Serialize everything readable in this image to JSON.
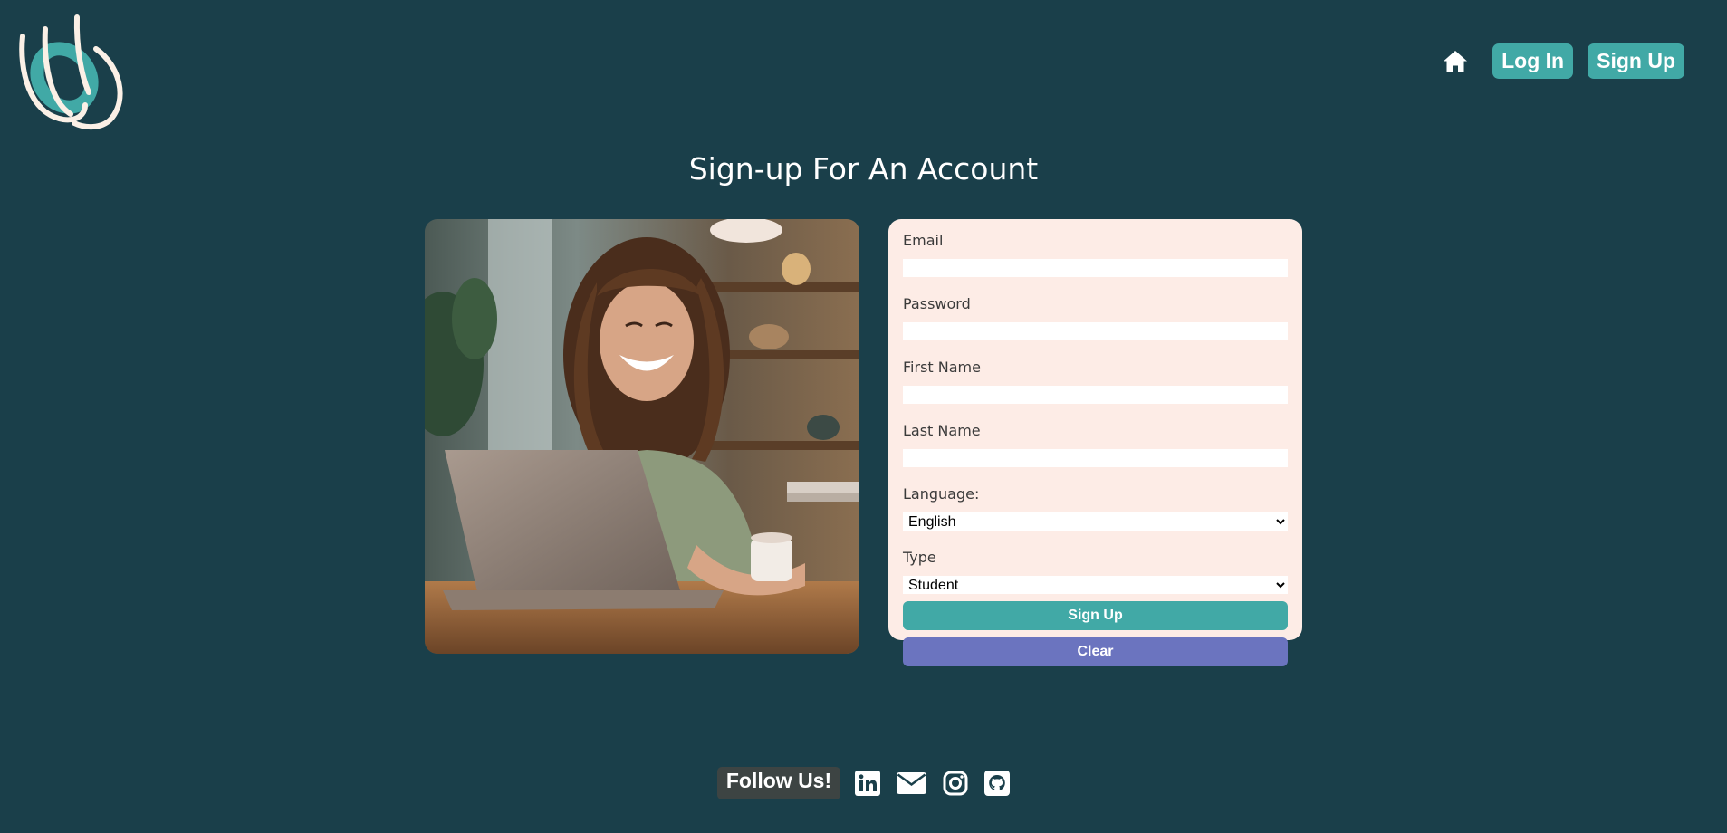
{
  "header": {
    "nav": {
      "home_icon": "home-icon",
      "login_label": "Log In",
      "signup_label": "Sign Up"
    }
  },
  "main": {
    "title": "Sign-up For An Account",
    "form": {
      "email_label": "Email",
      "email_value": "",
      "password_label": "Password",
      "password_value": "",
      "first_name_label": "First Name",
      "first_name_value": "",
      "last_name_label": "Last Name",
      "last_name_value": "",
      "language_label": "Language:",
      "language_selected": "English",
      "type_label": "Type",
      "type_selected": "Student",
      "signup_button": "Sign Up",
      "clear_button": "Clear"
    }
  },
  "footer": {
    "follow_label": "Follow Us!",
    "social_icons": [
      "linkedin-icon",
      "email-icon",
      "instagram-icon",
      "github-icon"
    ]
  },
  "colors": {
    "background": "#1a3f4a",
    "accent_teal": "#41a9a6",
    "clear_button": "#6b74bf",
    "form_card": "#fdece6",
    "logo_cream": "#fbf0e6"
  }
}
